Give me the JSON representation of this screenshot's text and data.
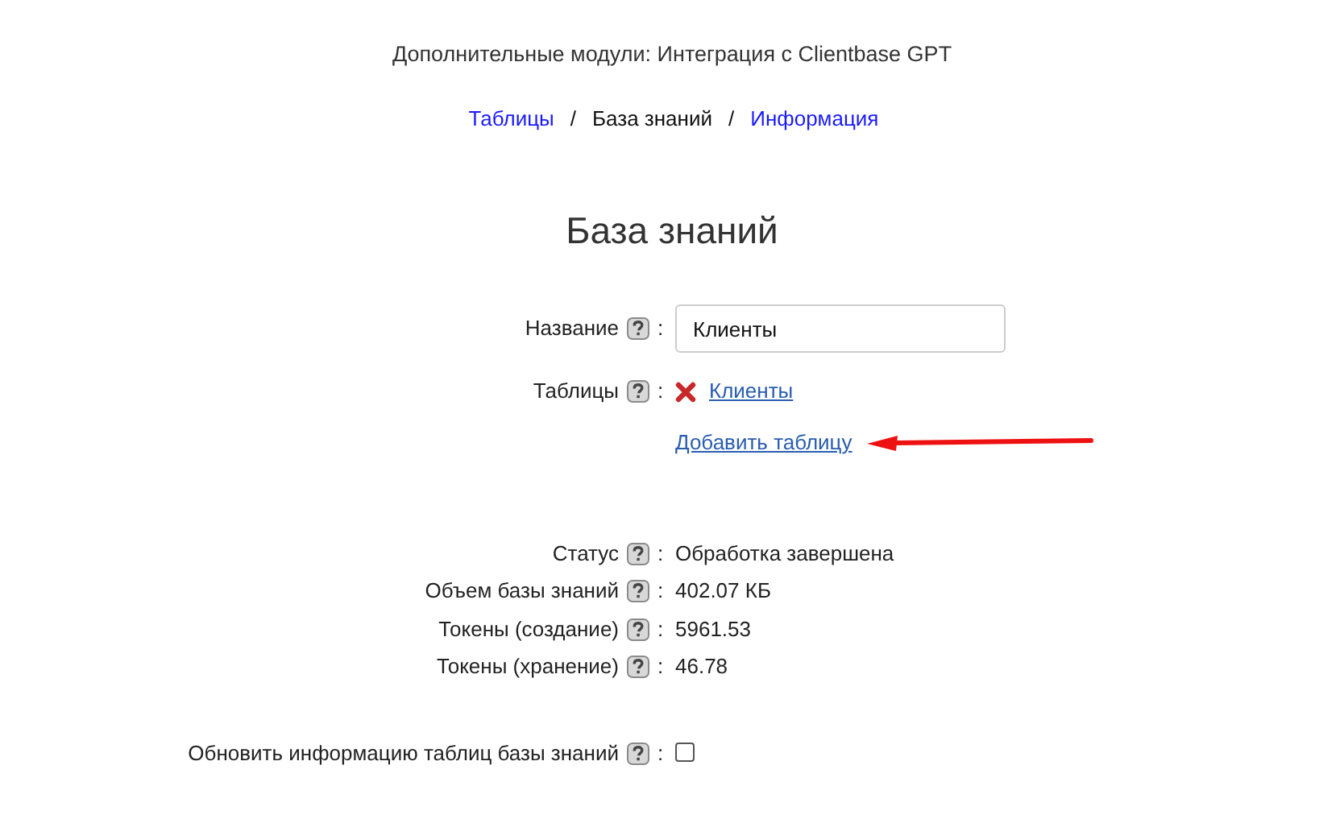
{
  "module_title": "Дополнительные модули: Интеграция с Clientbase GPT",
  "breadcrumbs": [
    {
      "kind": "link",
      "label": "Таблицы",
      "selected": false
    },
    {
      "kind": "separator",
      "label": "/"
    },
    {
      "kind": "link",
      "label": "База знаний",
      "selected": true
    },
    {
      "kind": "separator",
      "label": "/"
    },
    {
      "kind": "link",
      "label": "Информация",
      "selected": false
    }
  ],
  "heading": "База знаний",
  "form": [
    {
      "kind": "input",
      "label": "Название",
      "colon": ":",
      "value": "Клиенты"
    },
    {
      "kind": "tables",
      "label": "Таблицы",
      "colon": ":",
      "items": [
        {
          "name": "Клиенты"
        }
      ],
      "add_link": "Добавить таблицу"
    }
  ],
  "info": [
    {
      "label": "Статус",
      "colon": ":",
      "value": "Обработка завершена"
    },
    {
      "label": "Объем базы знаний",
      "colon": ":",
      "value": "402.07 КБ"
    },
    {
      "label": "Токены (создание)",
      "colon": ":",
      "value": "5961.53"
    },
    {
      "label": "Токены (хранение)",
      "colon": ":",
      "value": "46.78"
    }
  ],
  "refresh": {
    "label": "Обновить информацию таблиц базы знаний",
    "colon": ":",
    "checked": false
  }
}
